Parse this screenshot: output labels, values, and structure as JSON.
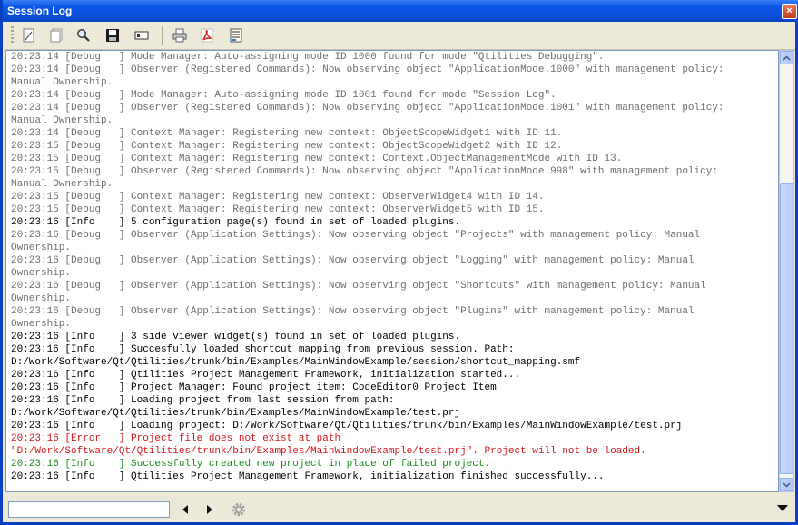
{
  "window": {
    "title": "Session Log",
    "close_glyph": "×"
  },
  "toolbar": {
    "buttons": [
      {
        "name": "clear-log",
        "icon": "clear-icon"
      },
      {
        "name": "copy",
        "icon": "copy-icon"
      },
      {
        "name": "find",
        "icon": "search-icon"
      },
      {
        "name": "save",
        "icon": "save-icon"
      },
      {
        "name": "select-all",
        "icon": "select-all-icon"
      },
      {
        "name": "print",
        "icon": "printer-icon"
      },
      {
        "name": "export-pdf",
        "icon": "pdf-icon"
      },
      {
        "name": "settings",
        "icon": "properties-icon"
      }
    ]
  },
  "colors": {
    "debug": "#6e6e6e",
    "info": "#000000",
    "error": "#d0171b",
    "success": "#1c8b1c",
    "title_bar": "#0a4fd8"
  },
  "log": {
    "lines": [
      {
        "text": "20:23:14 [Debug   ] Mode Manager: Auto-assigning mode ID 1000 found for mode \"Qtilities Debugging\".",
        "level": "debug"
      },
      {
        "text": "20:23:14 [Debug   ] Observer (Registered Commands): Now observing object \"ApplicationMode.1000\" with management policy:",
        "level": "debug"
      },
      {
        "text": "Manual Ownership.",
        "level": "debug"
      },
      {
        "text": "20:23:14 [Debug   ] Mode Manager: Auto-assigning mode ID 1001 found for mode \"Session Log\".",
        "level": "debug"
      },
      {
        "text": "20:23:14 [Debug   ] Observer (Registered Commands): Now observing object \"ApplicationMode.1001\" with management policy:",
        "level": "debug"
      },
      {
        "text": "Manual Ownership.",
        "level": "debug"
      },
      {
        "text": "20:23:14 [Debug   ] Context Manager: Registering new context: ObjectScopeWidget1 with ID 11.",
        "level": "debug"
      },
      {
        "text": "20:23:15 [Debug   ] Context Manager: Registering new context: ObjectScopeWidget2 with ID 12.",
        "level": "debug"
      },
      {
        "text": "20:23:15 [Debug   ] Context Manager: Registering new context: Context.ObjectManagementMode with ID 13.",
        "level": "debug"
      },
      {
        "text": "20:23:15 [Debug   ] Observer (Registered Commands): Now observing object \"ApplicationMode.998\" with management policy:",
        "level": "debug"
      },
      {
        "text": "Manual Ownership.",
        "level": "debug"
      },
      {
        "text": "20:23:15 [Debug   ] Context Manager: Registering new context: ObserverWidget4 with ID 14.",
        "level": "debug"
      },
      {
        "text": "20:23:15 [Debug   ] Context Manager: Registering new context: ObserverWidget5 with ID 15.",
        "level": "debug"
      },
      {
        "text": "20:23:16 [Info    ] 5 configuration page(s) found in set of loaded plugins.",
        "level": "info"
      },
      {
        "text": "20:23:16 [Debug   ] Observer (Application Settings): Now observing object \"Projects\" with management policy: Manual",
        "level": "debug"
      },
      {
        "text": "Ownership.",
        "level": "debug"
      },
      {
        "text": "20:23:16 [Debug   ] Observer (Application Settings): Now observing object \"Logging\" with management policy: Manual",
        "level": "debug"
      },
      {
        "text": "Ownership.",
        "level": "debug"
      },
      {
        "text": "20:23:16 [Debug   ] Observer (Application Settings): Now observing object \"Shortcuts\" with management policy: Manual",
        "level": "debug"
      },
      {
        "text": "Ownership.",
        "level": "debug"
      },
      {
        "text": "20:23:16 [Debug   ] Observer (Application Settings): Now observing object \"Plugins\" with management policy: Manual",
        "level": "debug"
      },
      {
        "text": "Ownership.",
        "level": "debug"
      },
      {
        "text": "20:23:16 [Info    ] 3 side viewer widget(s) found in set of loaded plugins.",
        "level": "info"
      },
      {
        "text": "20:23:16 [Info    ] Succesfully loaded shortcut mapping from previous session. Path:",
        "level": "info"
      },
      {
        "text": "D:/Work/Software/Qt/Qtilities/trunk/bin/Examples/MainWindowExample/session/shortcut_mapping.smf",
        "level": "info"
      },
      {
        "text": "20:23:16 [Info    ] Qtilities Project Management Framework, initialization started...",
        "level": "info"
      },
      {
        "text": "20:23:16 [Info    ] Project Manager: Found project item: CodeEditor0 Project Item",
        "level": "info"
      },
      {
        "text": "20:23:16 [Info    ] Loading project from last session from path:",
        "level": "info"
      },
      {
        "text": "D:/Work/Software/Qt/Qtilities/trunk/bin/Examples/MainWindowExample/test.prj",
        "level": "info"
      },
      {
        "text": "20:23:16 [Info    ] Loading project: D:/Work/Software/Qt/Qtilities/trunk/bin/Examples/MainWindowExample/test.prj",
        "level": "info"
      },
      {
        "text": "20:23:16 [Error   ] Project file does not exist at path",
        "level": "error"
      },
      {
        "text": "\"D:/Work/Software/Qt/Qtilities/trunk/bin/Examples/MainWindowExample/test.prj\". Project will not be loaded.",
        "level": "error"
      },
      {
        "text": "20:23:16 [Info    ] Successfully created new project in place of failed project.",
        "level": "success"
      },
      {
        "text": "20:23:16 [Info    ] Qtilities Project Management Framework, initialization finished successfully...",
        "level": "info"
      }
    ]
  },
  "search": {
    "value": "",
    "placeholder": ""
  },
  "bottom": {
    "prev_icon": "arrow-left-icon",
    "next_icon": "arrow-right-icon",
    "options_icon": "gear-icon",
    "menu_icon": "chevron-down-icon"
  }
}
